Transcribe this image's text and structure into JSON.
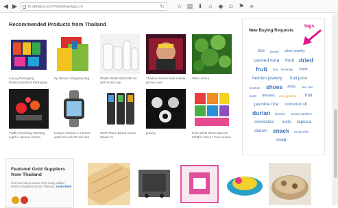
{
  "browser": {
    "url": "th.alibaba.com/?tracelog=ggs_th"
  },
  "recommended": {
    "title": "Recommended Products from Thailand",
    "products": [
      {
        "caption": "Luxury Packaging Box|Customized Packaging"
      },
      {
        "caption": "Pp Woven Shopping Bag"
      },
      {
        "caption": "Plastic Bottle 500/1000 ml with screw cap"
      },
      {
        "caption": "Thailand Hand made mobile phone case"
      },
      {
        "caption": "Wild Lettuce"
      },
      {
        "caption": "Traffic Revolving Warning Light in Various Colors"
      },
      {
        "caption": "Unique Android 4.4 Smart watch K6 wifi 3G sim slot"
      },
      {
        "caption": "3G/0 Phone Brand VCare Model V-I"
      },
      {
        "caption": "jewelry"
      },
      {
        "caption": "Polo Shirts Short Sleeves OEM/in Stock * Free screen"
      }
    ]
  },
  "buying_requests": {
    "title": "New Buying Requests",
    "tags": [
      {
        "text": "rice"
      },
      {
        "text": "jewelry"
      },
      {
        "text": "silver jewelry"
      },
      {
        "text": "canned tuna"
      },
      {
        "text": "food"
      },
      {
        "text": "dried"
      },
      {
        "text": "fruit"
      },
      {
        "text": "ring"
      },
      {
        "text": "beverage"
      },
      {
        "text": "sugar"
      },
      {
        "text": "fashion jewelry"
      },
      {
        "text": "fruit juice"
      },
      {
        "text": "furniture"
      },
      {
        "text": "shoes"
      },
      {
        "text": "shirts"
      },
      {
        "text": "skin care"
      },
      {
        "text": "pants"
      },
      {
        "text": "dresses"
      },
      {
        "text": "energy drink"
      },
      {
        "text": "fruit"
      },
      {
        "text": "jasmine rice"
      },
      {
        "text": "coconut oil"
      },
      {
        "text": "durian"
      },
      {
        "text": "bracelet"
      },
      {
        "text": "canned sardines"
      },
      {
        "text": "cosmetics"
      },
      {
        "text": "suits"
      },
      {
        "text": "tapioca"
      },
      {
        "text": "starch"
      },
      {
        "text": "snack"
      },
      {
        "text": "wood pellet"
      },
      {
        "text": "soap"
      }
    ]
  },
  "annotation": {
    "label": "tags",
    "color": "#e0148c"
  },
  "gold_suppliers": {
    "title": "Featured Gold Suppliers from Thailand",
    "desc": "Find out more & source from newly added Verified Suppliers across Thailand.",
    "learn_more": "Learn More"
  },
  "colors": {
    "tag": "#3a6fb5",
    "tag_accent": "#e89a1a",
    "title": "#333333"
  }
}
